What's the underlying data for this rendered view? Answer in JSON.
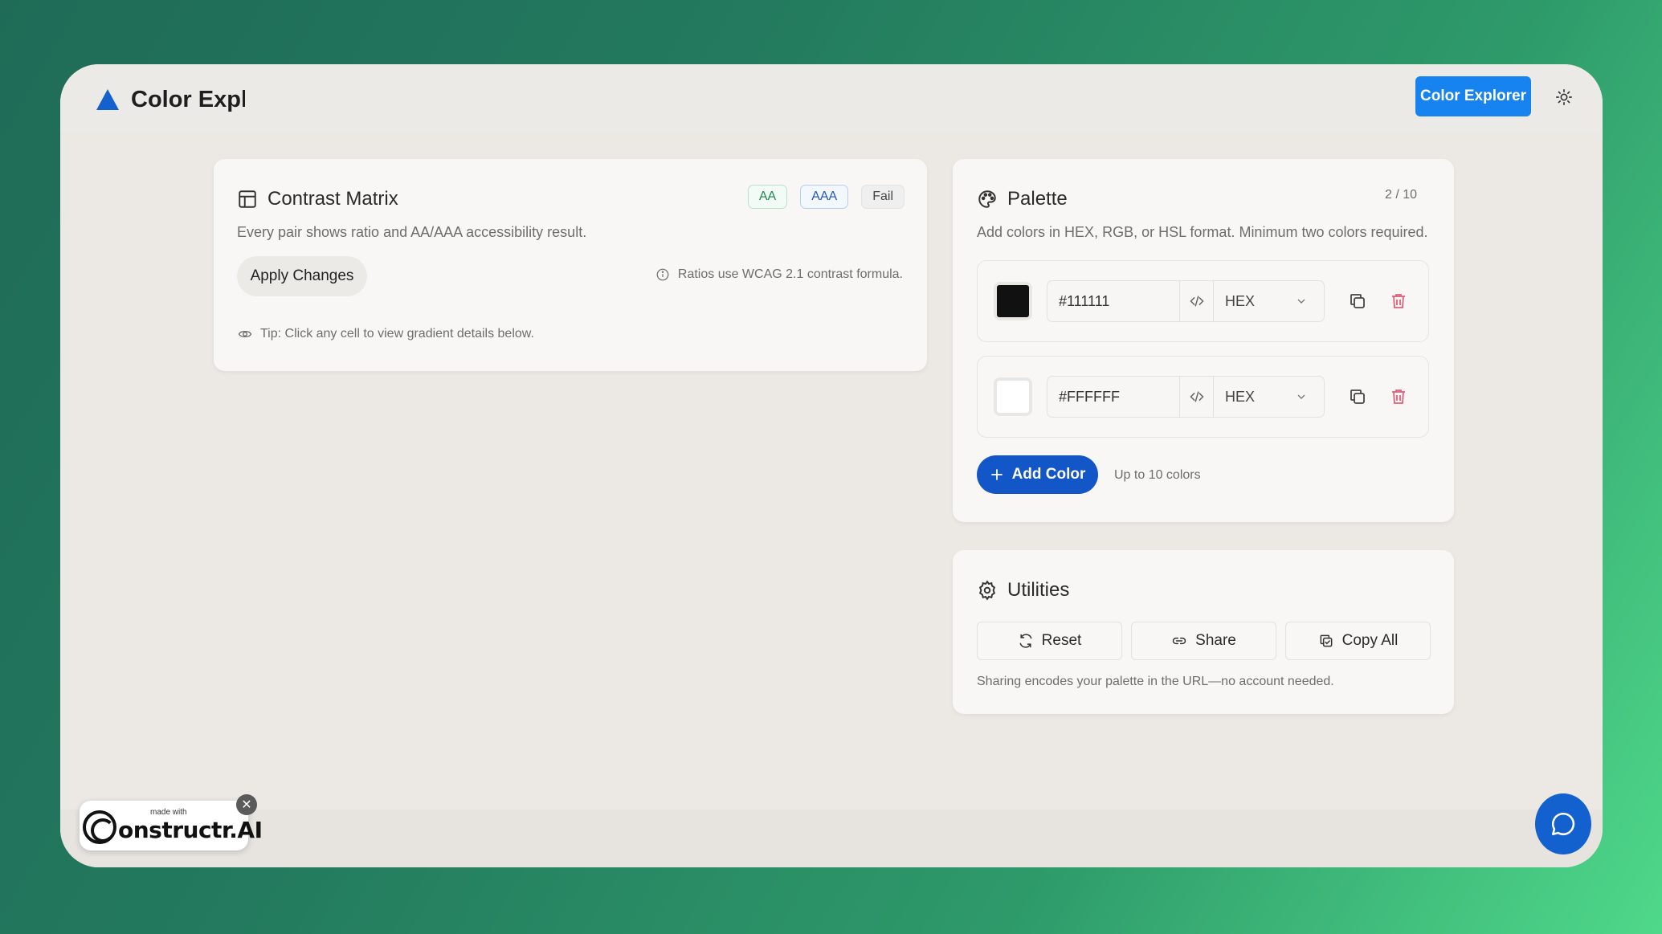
{
  "app": {
    "title": "Color Explorer",
    "nav_button": "Color Explorer"
  },
  "colors": {
    "accent": "#1683f0",
    "primary_button": "#1356c7",
    "delete": "#e0607a"
  },
  "matrix": {
    "title": "Contrast Matrix",
    "description": "Every pair shows ratio and AA/AAA accessibility result.",
    "badges": [
      "AA",
      "AAA",
      "Fail"
    ],
    "apply_label": "Apply Changes",
    "ratio_note": "Ratios use WCAG 2.1 contrast formula.",
    "tip": "Tip: Click any cell to view gradient details below."
  },
  "palette": {
    "title": "Palette",
    "count": "2 / 10",
    "description": "Add colors in HEX, RGB, or HSL format. Minimum two colors required.",
    "colors": [
      {
        "value": "#111111",
        "swatch": "#111111",
        "format": "HEX"
      },
      {
        "value": "#FFFFFF",
        "swatch": "#FFFFFF",
        "format": "HEX"
      }
    ],
    "add_label": "Add Color",
    "add_hint": "Up to 10 colors"
  },
  "utilities": {
    "title": "Utilities",
    "reset_label": "Reset",
    "share_label": "Share",
    "copy_all_label": "Copy All",
    "note": "Sharing encodes your palette in the URL—no account needed."
  },
  "badge": {
    "small": "made with",
    "brand": "onstructr.AI"
  },
  "icons": {
    "logo": "triangle-logo-icon",
    "theme": "sun-icon",
    "chat": "chat-bubble-icon"
  }
}
